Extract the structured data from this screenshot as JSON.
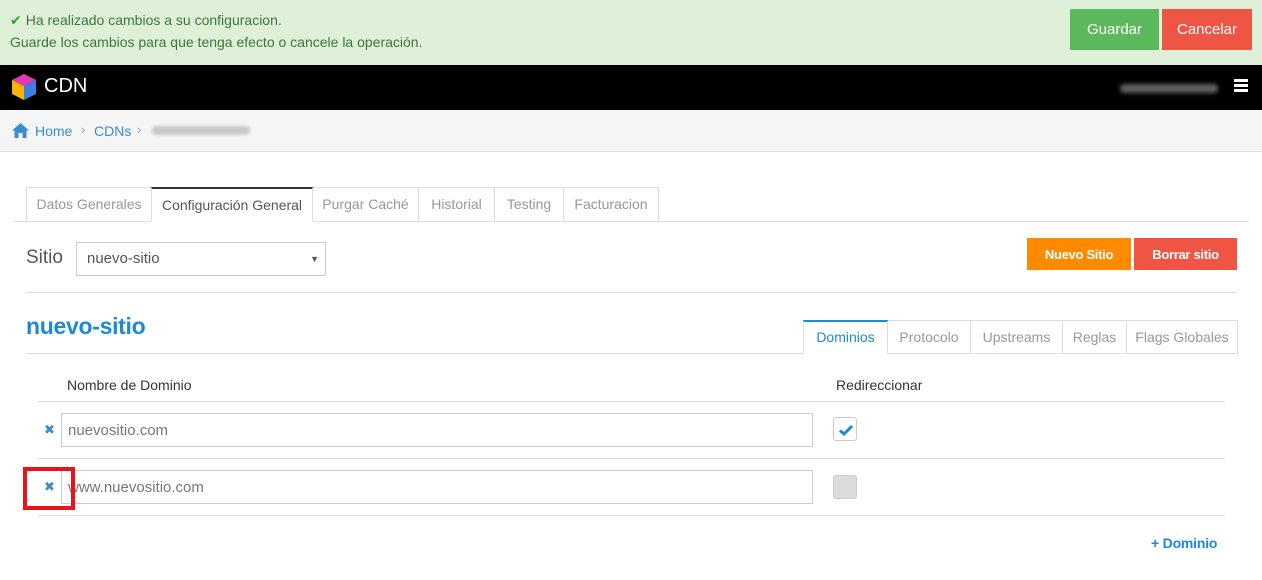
{
  "notice": {
    "line1": "Ha realizado cambios a su configuracion.",
    "line2": "Guarde los cambios para que tenga efecto o cancele la operación.",
    "save_label": "Guardar",
    "cancel_label": "Cancelar"
  },
  "navbar": {
    "brand": "CDN"
  },
  "breadcrumb": {
    "home": "Home",
    "cdns": "CDNs"
  },
  "main_tabs": [
    {
      "label": "Datos Generales"
    },
    {
      "label": "Configuración General"
    },
    {
      "label": "Purgar Caché"
    },
    {
      "label": "Historial"
    },
    {
      "label": "Testing"
    },
    {
      "label": "Facturacion"
    }
  ],
  "sitio": {
    "label": "Sitio",
    "selected": "nuevo-sitio",
    "new_label": "Nuevo Sitio",
    "delete_label": "Borrar sitio"
  },
  "site": {
    "title": "nuevo-sitio"
  },
  "sub_tabs": [
    {
      "label": "Dominios"
    },
    {
      "label": "Protocolo"
    },
    {
      "label": "Upstreams"
    },
    {
      "label": "Reglas"
    },
    {
      "label": "Flags Globales"
    }
  ],
  "domains": {
    "col_name": "Nombre de Dominio",
    "col_redirect": "Redireccionar",
    "rows": [
      {
        "value": "nuevositio.com",
        "redirect": true
      },
      {
        "value": "www.nuevositio.com",
        "redirect": false
      }
    ],
    "add_label": "+ Dominio"
  },
  "colors": {
    "accent": "#1d89d8",
    "success": "#5cb85c",
    "danger": "#ee5545",
    "warning": "#ff8a00"
  }
}
